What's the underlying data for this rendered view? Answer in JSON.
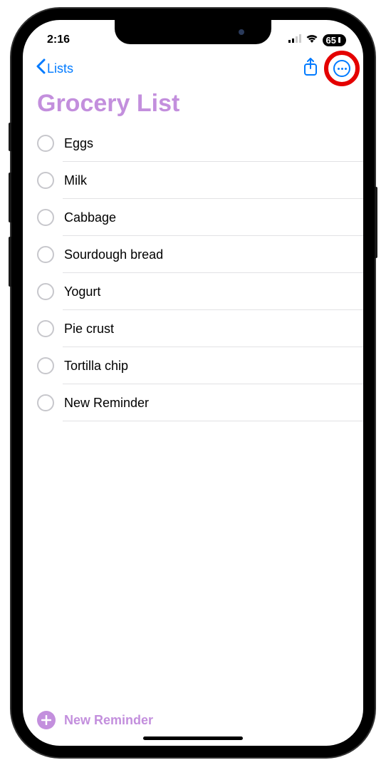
{
  "status": {
    "time": "2:16",
    "battery": "65"
  },
  "nav": {
    "back_label": "Lists"
  },
  "list": {
    "title": "Grocery List",
    "items": [
      {
        "title": "Eggs"
      },
      {
        "title": "Milk"
      },
      {
        "title": "Cabbage"
      },
      {
        "title": "Sourdough bread"
      },
      {
        "title": "Yogurt"
      },
      {
        "title": "Pie crust"
      },
      {
        "title": "Tortilla chip"
      },
      {
        "title": "New Reminder"
      }
    ]
  },
  "footer": {
    "new_reminder_label": "New Reminder"
  },
  "accent_color": "#c38fdd"
}
